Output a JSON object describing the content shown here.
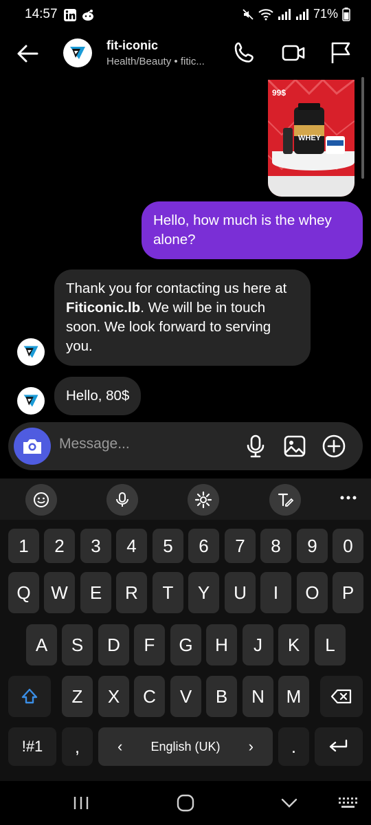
{
  "status": {
    "time": "14:57",
    "battery": "71%"
  },
  "header": {
    "name": "fit-iconic",
    "subtitle": "Health/Beauty • fitic..."
  },
  "product": {
    "price": "99$",
    "label": "WHEY"
  },
  "messages": [
    {
      "from": "me",
      "text": "Hello, how much is the whey alone?"
    },
    {
      "from": "them",
      "text_before": "Thank you for contacting us here at ",
      "text_bold": "Fiticonic.lb",
      "text_after": ". We will be in touch soon. We look forward to serving you."
    },
    {
      "from": "them",
      "text": "Hello, 80$"
    }
  ],
  "composer": {
    "placeholder": "Message..."
  },
  "keyboard": {
    "numbers": [
      "1",
      "2",
      "3",
      "4",
      "5",
      "6",
      "7",
      "8",
      "9",
      "0"
    ],
    "row1": [
      "Q",
      "W",
      "E",
      "R",
      "T",
      "Y",
      "U",
      "I",
      "O",
      "P"
    ],
    "row2": [
      "A",
      "S",
      "D",
      "F",
      "G",
      "H",
      "J",
      "K",
      "L"
    ],
    "row3": [
      "Z",
      "X",
      "C",
      "V",
      "B",
      "N",
      "M"
    ],
    "symbols": "!#1",
    "comma": ",",
    "space_label": "English (UK)",
    "space_left": "‹",
    "space_right": "›",
    "period": "."
  },
  "colors": {
    "outgoing_bubble": "#7a2fd6",
    "incoming_bubble": "#262626",
    "camera_button": "#4f5ce0",
    "shift_accent": "#3a8ee6"
  }
}
